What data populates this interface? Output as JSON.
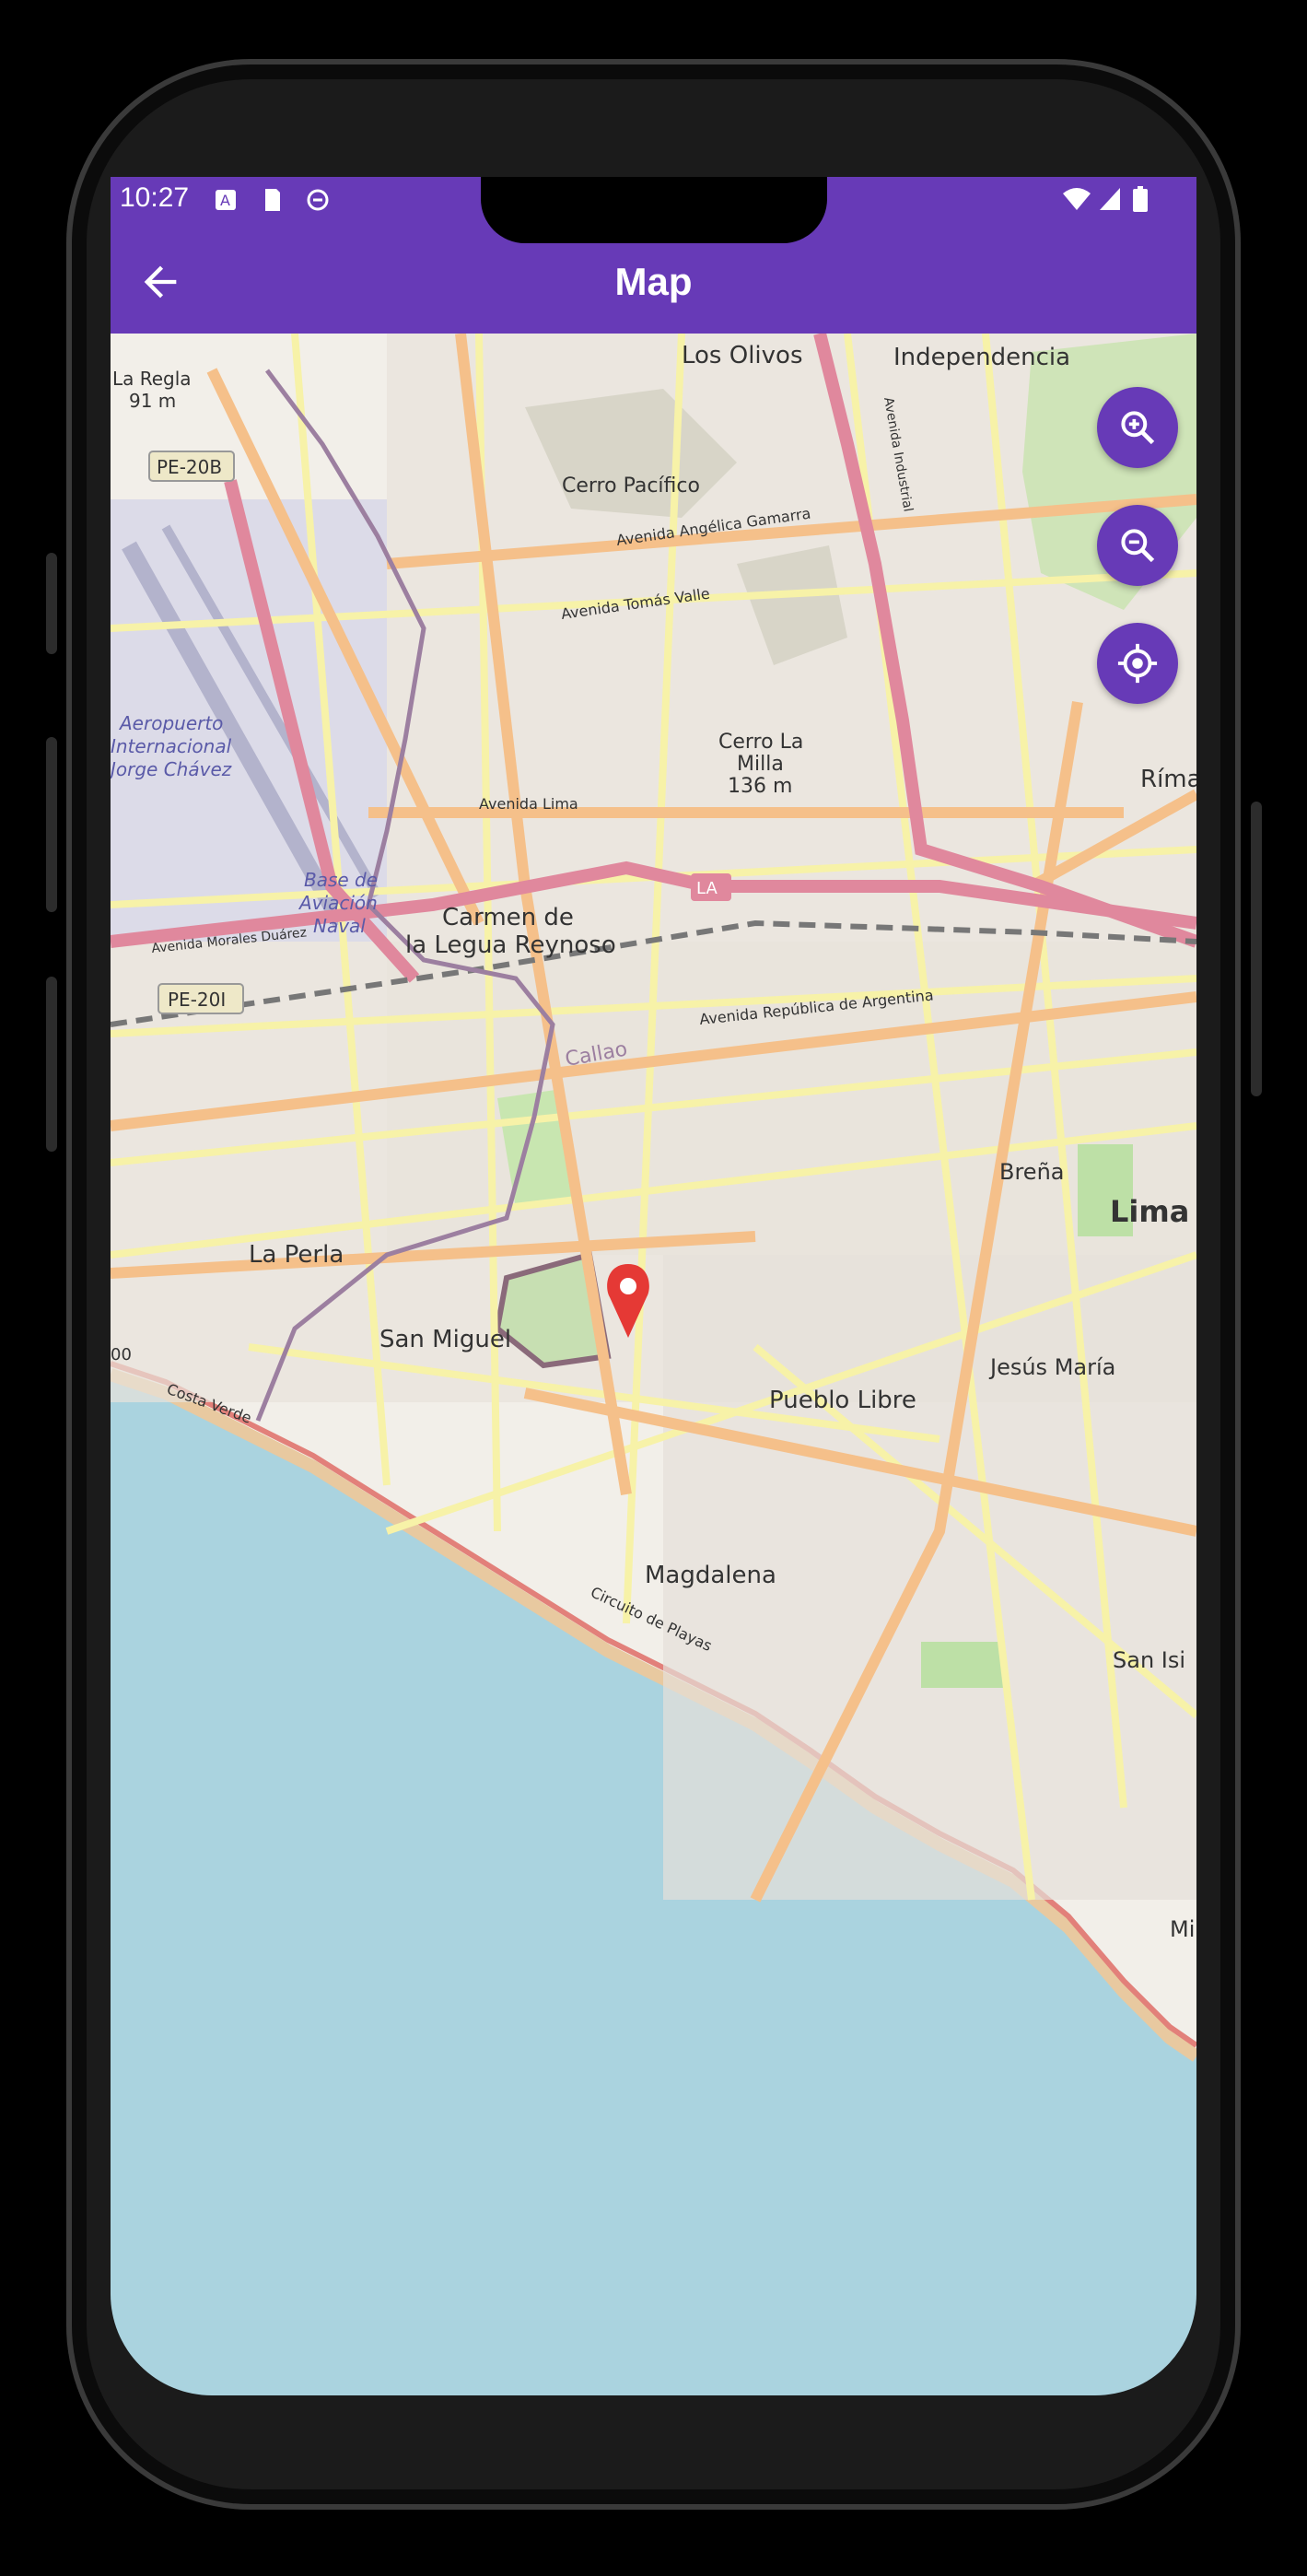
{
  "status": {
    "time": "10:27"
  },
  "appbar": {
    "title": "Map"
  },
  "map": {
    "labels": {
      "los_olivos": "Los Olivos",
      "independencia": "Independencia",
      "la_regla": "La Regla",
      "la_regla_elev": "91 m",
      "pe20b": "PE-20B",
      "cerro_pacifico": "Cerro Pacífico",
      "av_angelica": "Avenida Angélica Gamarra",
      "av_tomas_valle": "Avenida Tomás Valle",
      "aeropuerto": "Aeropuerto",
      "internacional": "Internacional",
      "jorge_chavez": "Jorge Chávez",
      "cerro_la_milla": "Cerro La",
      "cerro_la_milla2": "Milla",
      "cerro_la_milla_elev": "136 m",
      "rimac": "Rímac",
      "av_lima": "Avenida Lima",
      "base": "Base de",
      "base2": "Aviación",
      "base3": "Naval",
      "carmen": "Carmen de",
      "carmen2": "la Legua Reynoso",
      "av_morales": "Avenida Morales Duárez",
      "pe20i": "PE-20I",
      "av_argentina": "Avenida República de Argentina",
      "callao": "Callao",
      "brena": "Breña",
      "lima": "Lima",
      "la_perla": "La Perla",
      "san_miguel": "San Miguel",
      "jesus_maria": "Jesús María",
      "pueblo_libre": "Pueblo Libre",
      "costa_verde": "Costa Verde",
      "magdalena": "Magdalena",
      "circuito": "Circuito de Playas",
      "san_isidro": "San Isi",
      "mi": "Mi",
      "av_industrial": "Avenida Industrial",
      "la_badge": "LA",
      "route_00": "00"
    }
  },
  "controls": {
    "zoom_in": "zoom-in-icon",
    "zoom_out": "zoom-out-icon",
    "locate": "my-location-icon"
  },
  "colors": {
    "primary": "#673ab7",
    "marker": "#e53935",
    "water": "#aad3df",
    "land": "#f2efe9"
  }
}
